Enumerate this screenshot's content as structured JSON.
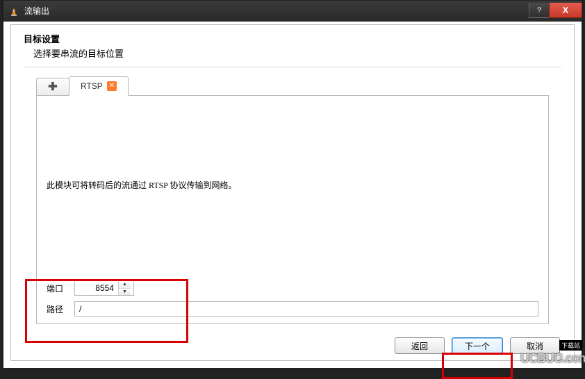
{
  "titlebar": {
    "title": "流输出",
    "help": "?",
    "close": "X"
  },
  "header": {
    "title": "目标设置",
    "subtitle": "选择要串流的目标位置"
  },
  "tabs": {
    "rtsp_label": "RTSP"
  },
  "module": {
    "description": "此模块可将转码后的流通过 RTSP 协议传输到网络。"
  },
  "fields": {
    "port_label": "端口",
    "port_value": "8554",
    "path_label": "路径",
    "path_value": "/"
  },
  "footer": {
    "back": "返回",
    "next": "下一个",
    "cancel": "取消"
  },
  "watermark": {
    "cn": "下载站",
    "en": "UCBUG.com"
  }
}
